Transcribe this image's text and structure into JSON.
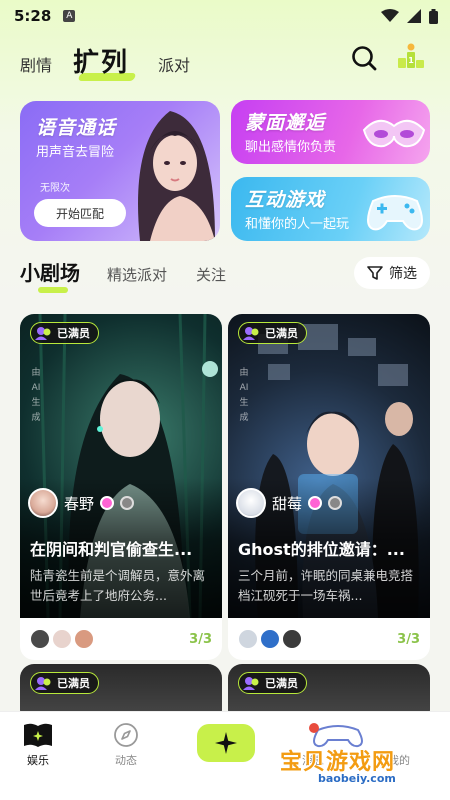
{
  "status_bar": {
    "time": "5:28",
    "notification_letter": "A"
  },
  "top_tabs": [
    {
      "label": "剧情"
    },
    {
      "label": "扩列"
    },
    {
      "label": "派对"
    }
  ],
  "banners": {
    "voice": {
      "title": "语音通话",
      "subtitle": "用声音去冒险",
      "hint": "无限次",
      "button": "开始匹配"
    },
    "mask": {
      "title": "蒙面邂逅",
      "subtitle": "聊出感情你负责"
    },
    "game": {
      "title": "互动游戏",
      "subtitle": "和懂你的人一起玩"
    }
  },
  "sub_tabs": [
    {
      "label": "小剧场"
    },
    {
      "label": "精选派对"
    },
    {
      "label": "关注"
    }
  ],
  "filter_label": "筛选",
  "cards": [
    {
      "badge": "已满员",
      "ai_mark": "由AI生成",
      "author": "春野",
      "title": "在阴间和判官偷查生...",
      "desc": "陆青瓷生前是个调解员，意外离世后竟考上了地府公务...",
      "count": "3/3"
    },
    {
      "badge": "已满员",
      "ai_mark": "由AI生成",
      "author": "甜莓",
      "title": "Ghost的排位邀请：...",
      "desc": "三个月前，许眠的同桌兼电竞搭档江砚死于一场车祸...",
      "count": "3/3"
    },
    {
      "badge": "已满员"
    },
    {
      "badge": "已满员"
    }
  ],
  "bottom_nav": [
    {
      "label": "娱乐"
    },
    {
      "label": "动态"
    },
    {
      "label": "消息"
    },
    {
      "label": "我的"
    }
  ],
  "watermark": {
    "text": "宝贝游戏网",
    "url": "baobeiy.com"
  },
  "colors": {
    "accent": "#c8f04a",
    "voice_banner": "#8a6cf5",
    "mask_banner": "#c63ff2",
    "game_banner": "#3bb8ef",
    "count_green": "#8bc34a"
  }
}
